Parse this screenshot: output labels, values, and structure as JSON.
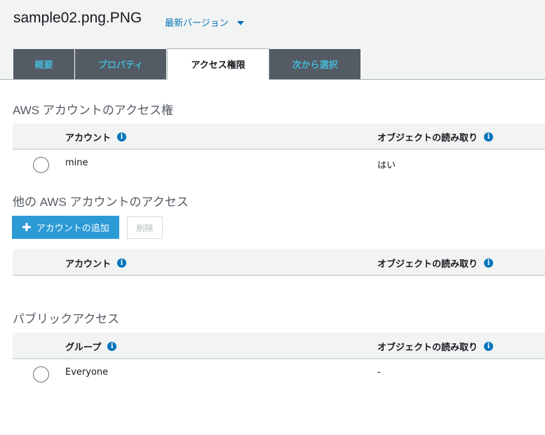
{
  "header": {
    "title": "sample02.png.PNG",
    "version_label": "最新バージョン"
  },
  "tabs": [
    {
      "label": "概要",
      "active": false
    },
    {
      "label": "プロパティ",
      "active": false
    },
    {
      "label": "アクセス権限",
      "active": true
    },
    {
      "label": "次から選択",
      "active": false
    }
  ],
  "aws_account_section": {
    "title": "AWS アカウントのアクセス権",
    "columns": [
      "アカウント",
      "オブジェクトの読み取り"
    ],
    "rows": [
      {
        "account": "mine",
        "read": "はい"
      }
    ]
  },
  "other_account_section": {
    "title": "他の AWS アカウントのアクセス",
    "add_button": "アカウントの追加",
    "delete_button": "削除",
    "columns": [
      "アカウント",
      "オブジェクトの読み取り"
    ],
    "rows": []
  },
  "public_access_section": {
    "title": "パブリックアクセス",
    "columns": [
      "グループ",
      "オブジェクトの読み取り"
    ],
    "rows": [
      {
        "group": "Everyone",
        "read": "-"
      }
    ]
  },
  "colors": {
    "link": "#0073bb",
    "tab_bg": "#545b64",
    "tab_text": "#44b9d6",
    "primary_button": "#2b9ad5"
  },
  "icons": {
    "info": "info-icon",
    "dropdown": "caret-down-icon",
    "add": "plus-icon"
  }
}
